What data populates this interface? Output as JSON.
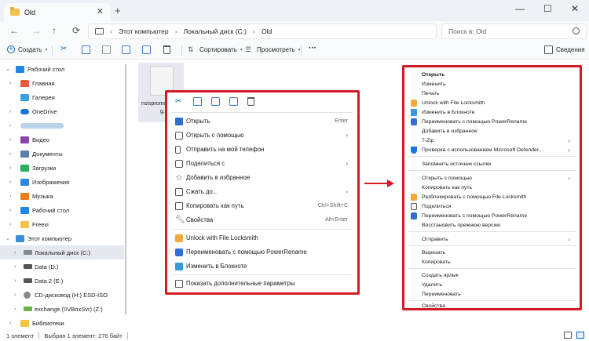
{
  "window": {
    "tab_title": "Old",
    "tab_close": "✕",
    "new_tab": "+",
    "minimize": "—",
    "maximize": "☐",
    "close": "✕"
  },
  "address": {
    "crumbs": [
      "Этот компьютер",
      "Локальный диск (C:)",
      "Old"
    ],
    "search_placeholder": "Поиск в: Old"
  },
  "toolbar": {
    "create": "Создать",
    "sort": "Сортировать",
    "view": "Просмотреть",
    "more": "···",
    "details": "Сведения"
  },
  "sidebar": {
    "items": [
      {
        "label": "Рабочий стол",
        "expanded": true
      },
      {
        "label": "Главная"
      },
      {
        "label": "Галерея"
      },
      {
        "label": "OneDrive"
      },
      {
        "label": ""
      },
      {
        "label": "Видео"
      },
      {
        "label": "Документы"
      },
      {
        "label": "Загрузки"
      },
      {
        "label": "Изображения"
      },
      {
        "label": "Музыка"
      },
      {
        "label": "Рабочий стол"
      },
      {
        "label": "Freevi"
      },
      {
        "label": "Этот компьютер"
      },
      {
        "label": "Локальный диск (C:)"
      },
      {
        "label": "Data (D:)"
      },
      {
        "label": "Data 2 (E:)"
      },
      {
        "label": "CD-дисковод (H:) ESD-ISO"
      },
      {
        "label": "exchange (\\\\VBoxSvr) (Z:)"
      },
      {
        "label": "Библиотеки"
      }
    ]
  },
  "file": {
    "name_line1": "nsispromot",
    "name_line2": "g.t"
  },
  "status": {
    "count": "1 элемент",
    "selection": "Выбран 1 элемент: 276 байт"
  },
  "menu_left": {
    "items": [
      {
        "label": "Открыть",
        "shortcut": "Enter"
      },
      {
        "label": "Открыть с помощью",
        "arrow": "›"
      },
      {
        "label": "Отправить на мой телефон"
      },
      {
        "label": "Поделиться с",
        "arrow": "›"
      },
      {
        "label": "Добавить в избранное"
      },
      {
        "label": "Сжать до...",
        "arrow": "›"
      },
      {
        "label": "Копировать как путь",
        "shortcut": "Ctrl+Shift+C"
      },
      {
        "label": "Свойства",
        "shortcut": "Alt+Enter"
      },
      {
        "label": "Unlock with File Locksmith"
      },
      {
        "label": "Переименовать с помощью PowerRename"
      },
      {
        "label": "Изменить в Блокноте"
      },
      {
        "label": "Показать дополнительные параметры"
      }
    ]
  },
  "menu_right": {
    "items": [
      {
        "label": "Открыть",
        "bold": true
      },
      {
        "label": "Изменить"
      },
      {
        "label": "Печать"
      },
      {
        "label": "Unlock with File Locksmith"
      },
      {
        "label": "Изменить в Блокноте"
      },
      {
        "label": "Переименовать с помощью PowerRename"
      },
      {
        "label": "Добавить в избранное"
      },
      {
        "label": "7-Zip",
        "arrow": "›"
      },
      {
        "label": "Проверка с использованием Microsoft Defender...",
        "arrow": "›"
      },
      {
        "label": "Запомнить источник ссылки"
      },
      {
        "label": "Открыть с помощью",
        "arrow": "›"
      },
      {
        "label": "Копировать как путь"
      },
      {
        "label": "Разблокировать с помощью File Locksmith"
      },
      {
        "label": "Поделиться"
      },
      {
        "label": "Переименовать с помощью PowerRename"
      },
      {
        "label": "Восстановить прежнюю версию"
      },
      {
        "label": "Отправить",
        "arrow": "›"
      },
      {
        "label": "Вырезать"
      },
      {
        "label": "Копировать"
      },
      {
        "label": "Создать ярлык"
      },
      {
        "label": "Удалить"
      },
      {
        "label": "Переименовать"
      },
      {
        "label": "Свойства"
      }
    ]
  },
  "colors": {
    "highlight_red": "#d41a25",
    "accent_blue": "#0067c0",
    "folder_yellow": "#f2c14e"
  }
}
